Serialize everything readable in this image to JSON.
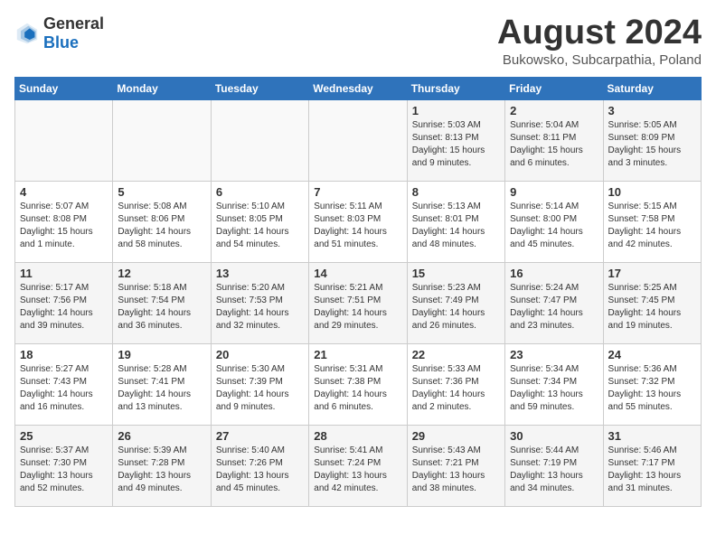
{
  "header": {
    "logo_general": "General",
    "logo_blue": "Blue",
    "month_title": "August 2024",
    "subtitle": "Bukowsko, Subcarpathia, Poland"
  },
  "days_of_week": [
    "Sunday",
    "Monday",
    "Tuesday",
    "Wednesday",
    "Thursday",
    "Friday",
    "Saturday"
  ],
  "weeks": [
    [
      {
        "day": "",
        "info": ""
      },
      {
        "day": "",
        "info": ""
      },
      {
        "day": "",
        "info": ""
      },
      {
        "day": "",
        "info": ""
      },
      {
        "day": "1",
        "info": "Sunrise: 5:03 AM\nSunset: 8:13 PM\nDaylight: 15 hours\nand 9 minutes."
      },
      {
        "day": "2",
        "info": "Sunrise: 5:04 AM\nSunset: 8:11 PM\nDaylight: 15 hours\nand 6 minutes."
      },
      {
        "day": "3",
        "info": "Sunrise: 5:05 AM\nSunset: 8:09 PM\nDaylight: 15 hours\nand 3 minutes."
      }
    ],
    [
      {
        "day": "4",
        "info": "Sunrise: 5:07 AM\nSunset: 8:08 PM\nDaylight: 15 hours\nand 1 minute."
      },
      {
        "day": "5",
        "info": "Sunrise: 5:08 AM\nSunset: 8:06 PM\nDaylight: 14 hours\nand 58 minutes."
      },
      {
        "day": "6",
        "info": "Sunrise: 5:10 AM\nSunset: 8:05 PM\nDaylight: 14 hours\nand 54 minutes."
      },
      {
        "day": "7",
        "info": "Sunrise: 5:11 AM\nSunset: 8:03 PM\nDaylight: 14 hours\nand 51 minutes."
      },
      {
        "day": "8",
        "info": "Sunrise: 5:13 AM\nSunset: 8:01 PM\nDaylight: 14 hours\nand 48 minutes."
      },
      {
        "day": "9",
        "info": "Sunrise: 5:14 AM\nSunset: 8:00 PM\nDaylight: 14 hours\nand 45 minutes."
      },
      {
        "day": "10",
        "info": "Sunrise: 5:15 AM\nSunset: 7:58 PM\nDaylight: 14 hours\nand 42 minutes."
      }
    ],
    [
      {
        "day": "11",
        "info": "Sunrise: 5:17 AM\nSunset: 7:56 PM\nDaylight: 14 hours\nand 39 minutes."
      },
      {
        "day": "12",
        "info": "Sunrise: 5:18 AM\nSunset: 7:54 PM\nDaylight: 14 hours\nand 36 minutes."
      },
      {
        "day": "13",
        "info": "Sunrise: 5:20 AM\nSunset: 7:53 PM\nDaylight: 14 hours\nand 32 minutes."
      },
      {
        "day": "14",
        "info": "Sunrise: 5:21 AM\nSunset: 7:51 PM\nDaylight: 14 hours\nand 29 minutes."
      },
      {
        "day": "15",
        "info": "Sunrise: 5:23 AM\nSunset: 7:49 PM\nDaylight: 14 hours\nand 26 minutes."
      },
      {
        "day": "16",
        "info": "Sunrise: 5:24 AM\nSunset: 7:47 PM\nDaylight: 14 hours\nand 23 minutes."
      },
      {
        "day": "17",
        "info": "Sunrise: 5:25 AM\nSunset: 7:45 PM\nDaylight: 14 hours\nand 19 minutes."
      }
    ],
    [
      {
        "day": "18",
        "info": "Sunrise: 5:27 AM\nSunset: 7:43 PM\nDaylight: 14 hours\nand 16 minutes."
      },
      {
        "day": "19",
        "info": "Sunrise: 5:28 AM\nSunset: 7:41 PM\nDaylight: 14 hours\nand 13 minutes."
      },
      {
        "day": "20",
        "info": "Sunrise: 5:30 AM\nSunset: 7:39 PM\nDaylight: 14 hours\nand 9 minutes."
      },
      {
        "day": "21",
        "info": "Sunrise: 5:31 AM\nSunset: 7:38 PM\nDaylight: 14 hours\nand 6 minutes."
      },
      {
        "day": "22",
        "info": "Sunrise: 5:33 AM\nSunset: 7:36 PM\nDaylight: 14 hours\nand 2 minutes."
      },
      {
        "day": "23",
        "info": "Sunrise: 5:34 AM\nSunset: 7:34 PM\nDaylight: 13 hours\nand 59 minutes."
      },
      {
        "day": "24",
        "info": "Sunrise: 5:36 AM\nSunset: 7:32 PM\nDaylight: 13 hours\nand 55 minutes."
      }
    ],
    [
      {
        "day": "25",
        "info": "Sunrise: 5:37 AM\nSunset: 7:30 PM\nDaylight: 13 hours\nand 52 minutes."
      },
      {
        "day": "26",
        "info": "Sunrise: 5:39 AM\nSunset: 7:28 PM\nDaylight: 13 hours\nand 49 minutes."
      },
      {
        "day": "27",
        "info": "Sunrise: 5:40 AM\nSunset: 7:26 PM\nDaylight: 13 hours\nand 45 minutes."
      },
      {
        "day": "28",
        "info": "Sunrise: 5:41 AM\nSunset: 7:24 PM\nDaylight: 13 hours\nand 42 minutes."
      },
      {
        "day": "29",
        "info": "Sunrise: 5:43 AM\nSunset: 7:21 PM\nDaylight: 13 hours\nand 38 minutes."
      },
      {
        "day": "30",
        "info": "Sunrise: 5:44 AM\nSunset: 7:19 PM\nDaylight: 13 hours\nand 34 minutes."
      },
      {
        "day": "31",
        "info": "Sunrise: 5:46 AM\nSunset: 7:17 PM\nDaylight: 13 hours\nand 31 minutes."
      }
    ]
  ]
}
